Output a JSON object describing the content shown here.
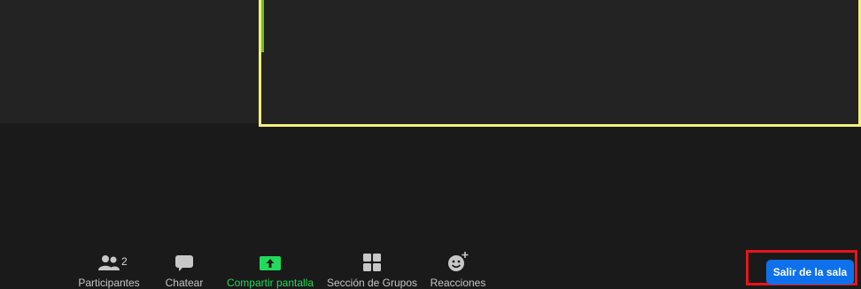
{
  "toolbar": {
    "participants": {
      "label": "Participantes",
      "count": "2",
      "icon": "participants-icon"
    },
    "chat": {
      "label": "Chatear",
      "icon": "chat-bubble-icon"
    },
    "share": {
      "label": "Compartir pantalla",
      "icon": "share-screen-icon",
      "color": "#23d959"
    },
    "breakout": {
      "label": "Sección de Grupos",
      "icon": "breakout-rooms-icon"
    },
    "reactions": {
      "label": "Reacciones",
      "icon": "add-reaction-icon"
    }
  },
  "leave": {
    "label": "Salir de la sala",
    "color": "#0e71eb",
    "highlight_color": "#e8141a"
  },
  "colors": {
    "background": "#1a1a1a",
    "tile": "#232323",
    "active_speaker_border": "#f2f07a"
  }
}
